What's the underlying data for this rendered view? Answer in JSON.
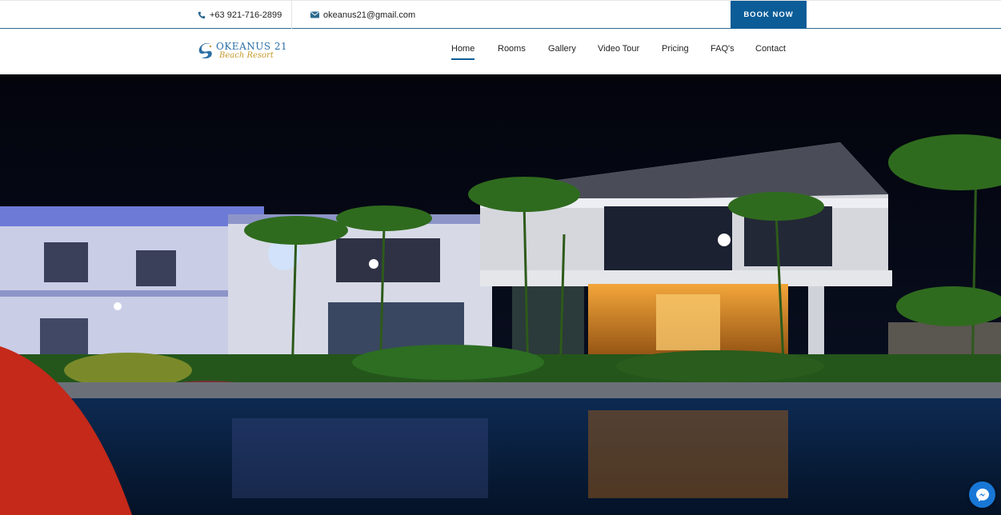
{
  "topbar": {
    "phone": "+63 921-716-2899",
    "email": "okeanus21@gmail.com",
    "book_label": "BOOK NOW"
  },
  "logo": {
    "line1": "OKEANUS 21",
    "line2": "Beach Resort"
  },
  "nav": {
    "items": [
      {
        "label": "Home",
        "active": true
      },
      {
        "label": "Rooms"
      },
      {
        "label": "Gallery"
      },
      {
        "label": "Video Tour"
      },
      {
        "label": "Pricing"
      },
      {
        "label": "FAQ's"
      },
      {
        "label": "Contact"
      }
    ]
  },
  "colors": {
    "accent": "#0b5c97",
    "messenger": "#1877d6"
  },
  "icons": {
    "phone": "phone-icon",
    "email": "envelope-icon",
    "chat": "messenger-icon"
  }
}
